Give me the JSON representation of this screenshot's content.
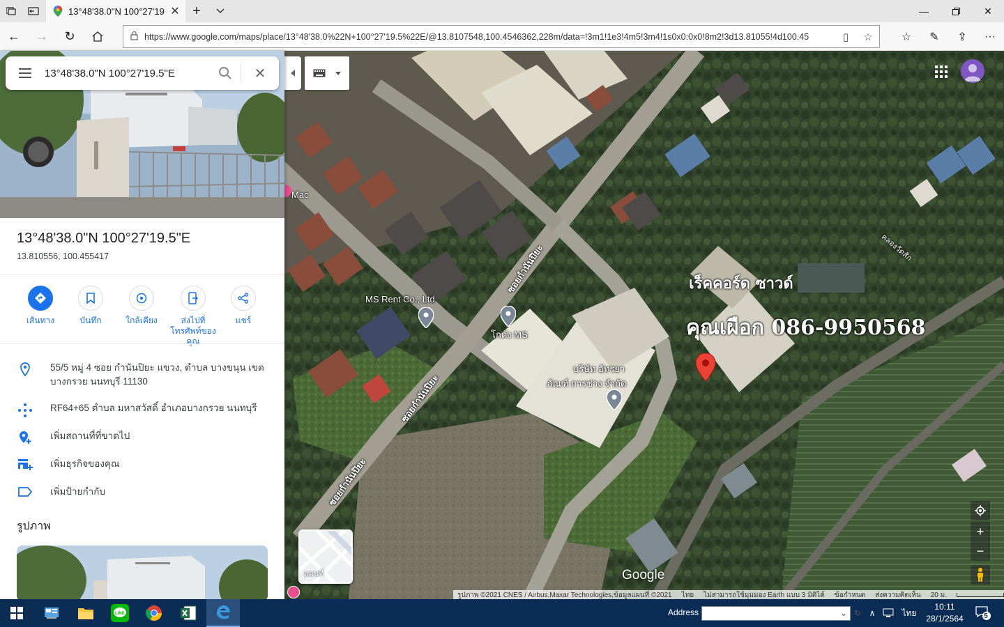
{
  "browser": {
    "tab_title": "13°48'38.0\"N 100°27'19",
    "url": "https://www.google.com/maps/place/13°48'38.0%22N+100°27'19.5%22E/@13.8107548,100.4546362,228m/data=!3m1!1e3!4m5!3m4!1s0x0:0x0!8m2!3d13.81055!4d100.45"
  },
  "search": {
    "query": "13°48'38.0\"N 100°27'19.5\"E"
  },
  "place": {
    "title": "13°48'38.0\"N 100°27'19.5\"E",
    "decimal": "13.810556, 100.455417",
    "actions": [
      {
        "label": "เส้นทาง"
      },
      {
        "label": "บันทึก"
      },
      {
        "label": "ใกล้เคียง"
      },
      {
        "label": "ส่งไปที่โทรศัพท์ของคุณ"
      },
      {
        "label": "แชร์"
      }
    ],
    "address": "55/5 หมู่ 4 ซอย กำนันปิยะ แขวง, ตำบล บางขนุน เขต บางกรวย นนทบุรี 11130",
    "plus_code": "RF64+65 ตำบล มหาสวัสดิ์ อำเภอบางกรวย นนทบุรี",
    "add_missing": "เพิ่มสถานที่ที่ขาดไป",
    "add_business": "เพิ่มธุรกิจของคุณ",
    "add_label": "เพิ่มป้ายกำกับ",
    "photos_heading": "รูปภาพ"
  },
  "map": {
    "labels": {
      "mac": "Mac",
      "ms_rent": "MS Rent Co., Ltd",
      "ms_warehouse": "โกดัง MS",
      "company_line1": "บริษัท อัทรยา",
      "company_line2": "ภัณฑ์ การช่าง จำกัด",
      "road1": "ซอยกำนันปิยะ",
      "road2": "ซอยกำนันปิยะ",
      "road3": "ซอยกำนันปิยะ",
      "canal": "คลองวัดสัก"
    },
    "overlay": {
      "line1": "เร็คคอร์ด ซาวด์",
      "line2": "คุณเผือก 086-9950568"
    },
    "google_logo": "Google",
    "layer_label": "แผนที่",
    "attribution": {
      "imagery": "รูปภาพ ©2021 CNES / Airbus,Maxar Technologies,ข้อมูลแผนที่ ©2021",
      "lang": "ไทย",
      "earth": "ไม่สามารถใช้มุมมอง Earth แบบ 3 มิติได้",
      "terms": "ข้อกำหนด",
      "feedback": "ส่งความคิดเห็น",
      "scale": "20 ม."
    }
  },
  "taskbar": {
    "address_label": "Address",
    "lang": "ไทย",
    "time": "10:11",
    "date": "28/1/2564",
    "notifications": "5"
  },
  "colors": {
    "accent_blue": "#1a73e8",
    "pin_red": "#ea4335",
    "taskbar": "#0b2d55"
  }
}
